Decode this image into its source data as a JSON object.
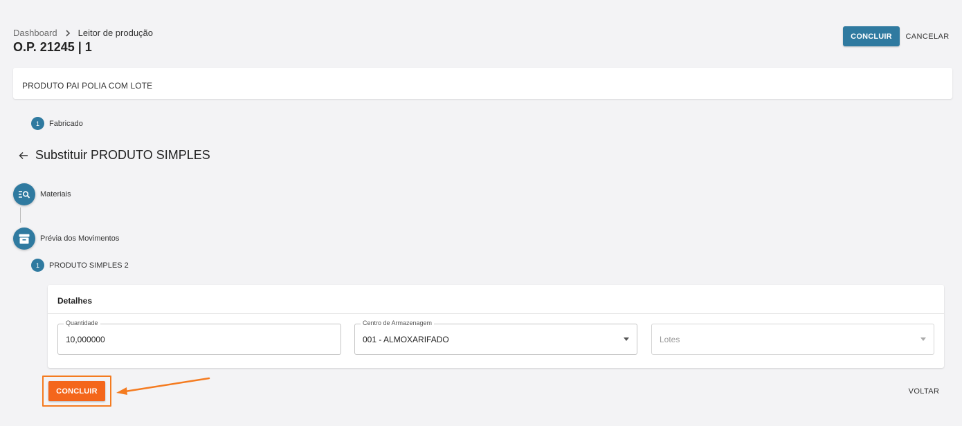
{
  "breadcrumb": {
    "root": "Dashboard",
    "current": "Leitor de produção"
  },
  "page": {
    "title": "O.P. 21245 | 1"
  },
  "header_actions": {
    "concluir": "CONCLUIR",
    "cancelar": "CANCELAR"
  },
  "product": {
    "name": "PRODUTO PAI POLIA COM LOTE"
  },
  "fabricado_step": {
    "number": "1",
    "label": "Fabricado"
  },
  "section": {
    "title": "Substituir PRODUTO SIMPLES"
  },
  "steps": {
    "materiais": "Materiais",
    "previa": "Prévia dos Movimentos"
  },
  "sub_step": {
    "number": "1",
    "label": "PRODUTO SIMPLES 2"
  },
  "details": {
    "title": "Detalhes",
    "quantidade": {
      "label": "Quantidade",
      "value": "10,000000"
    },
    "centro": {
      "label": "Centro de Armazenagem",
      "value": "001 - ALMOXARIFADO"
    },
    "lotes": {
      "placeholder": "Lotes"
    }
  },
  "bottom_actions": {
    "concluir": "CONCLUIR",
    "voltar": "VOLTAR"
  },
  "colors": {
    "primary": "#2f7aa0",
    "accent": "#f4661b",
    "highlight": "#f47b20",
    "background": "#f3f3f5"
  },
  "icons": {
    "breadcrumb_separator": "chevron-right-icon",
    "back": "arrow-left-icon",
    "materiais": "list-search-icon",
    "previa": "archive-box-icon",
    "callout": "arrow-pointer-icon"
  }
}
